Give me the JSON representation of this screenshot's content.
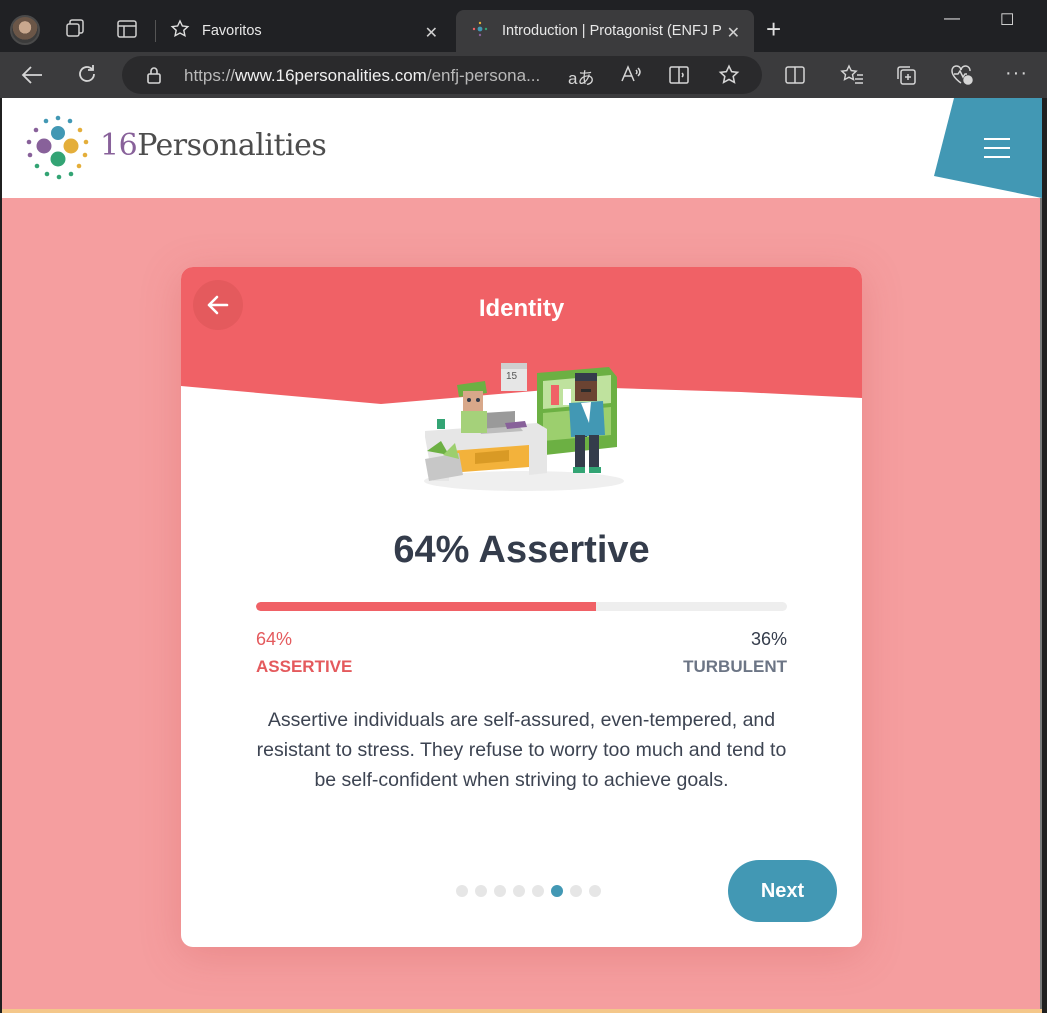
{
  "browser": {
    "tabs": [
      {
        "title": "Favoritos",
        "active": false
      },
      {
        "title": "Introduction | Protagonist (ENFJ Personality)",
        "active": true
      }
    ],
    "url_prefix": "https://",
    "url_domain": "www.16personalities.com",
    "url_path": "/enfj-persona...",
    "close_glyph": "✕",
    "new_tab_glyph": "+",
    "minimize_glyph": "—",
    "maximize_glyph": "☐"
  },
  "site": {
    "logo_number": "16",
    "logo_word": "Personalities"
  },
  "card": {
    "title": "Identity",
    "headline": "64% Assertive",
    "progress_fraction": 0.64,
    "left_percent": "64%",
    "left_label": "ASSERTIVE",
    "right_percent": "36%",
    "right_label": "TURBULENT",
    "description": "Assertive individuals are self-assured, even-tempered, and resistant to stress. They refuse to worry too much and tend to be self-confident when striving to achieve goals.",
    "pagination": {
      "total": 8,
      "active_index": 5
    },
    "next_label": "Next",
    "calendar_number": "15"
  },
  "colors": {
    "accent_red": "#f06166",
    "page_bg": "#f59e9f",
    "accent_blue": "#4298b4",
    "logo_purple": "#88619a"
  }
}
